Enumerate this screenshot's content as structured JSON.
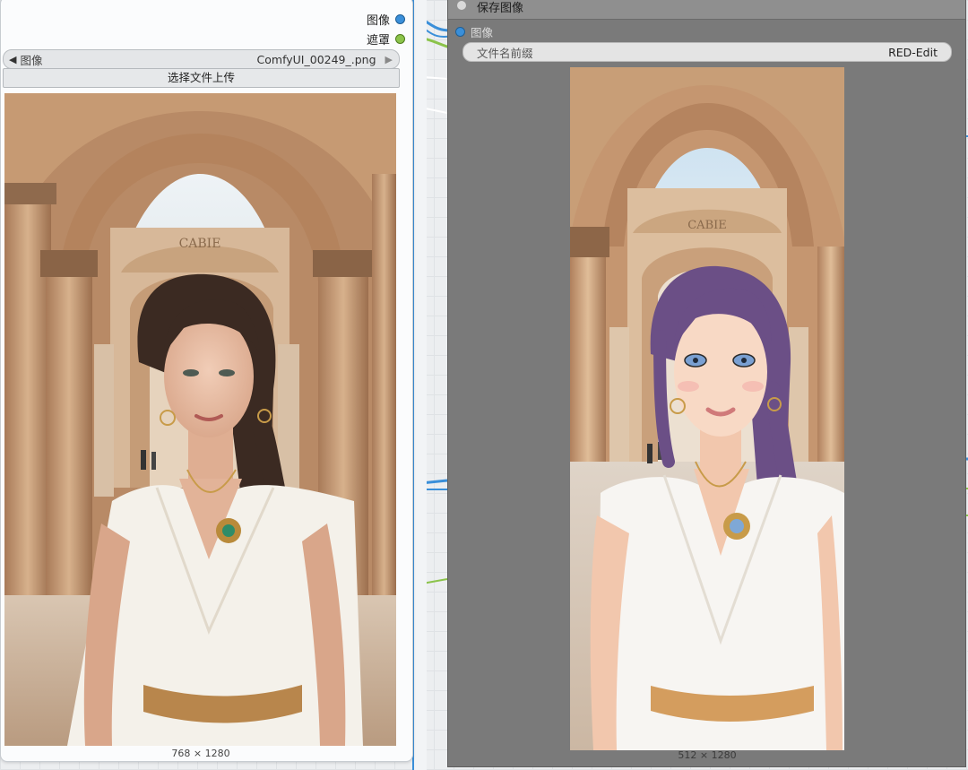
{
  "load_node": {
    "outputs": [
      {
        "label": "图像",
        "color": "blue"
      },
      {
        "label": "遮罩",
        "color": "green"
      }
    ],
    "combo": {
      "arrow_left": "◀",
      "label": "图像",
      "value": "ComfyUI_00249_.png",
      "arrow_right": "▶"
    },
    "upload_label": "选择文件上传",
    "preview_size": "768 × 1280"
  },
  "save_node": {
    "title": "保存图像",
    "input_label": "图像",
    "filename_prefix_label": "文件名前缀",
    "filename_prefix_value": "RED-Edit",
    "preview_size": "512 × 1280"
  },
  "photo": {
    "sign_text": "CABIE"
  },
  "colors": {
    "link_blue": "#3a8fd9",
    "link_green": "#8bc34a",
    "stone": "#c9a07a",
    "sky": "#dfe9f1",
    "dress": "#f4f1ea"
  }
}
